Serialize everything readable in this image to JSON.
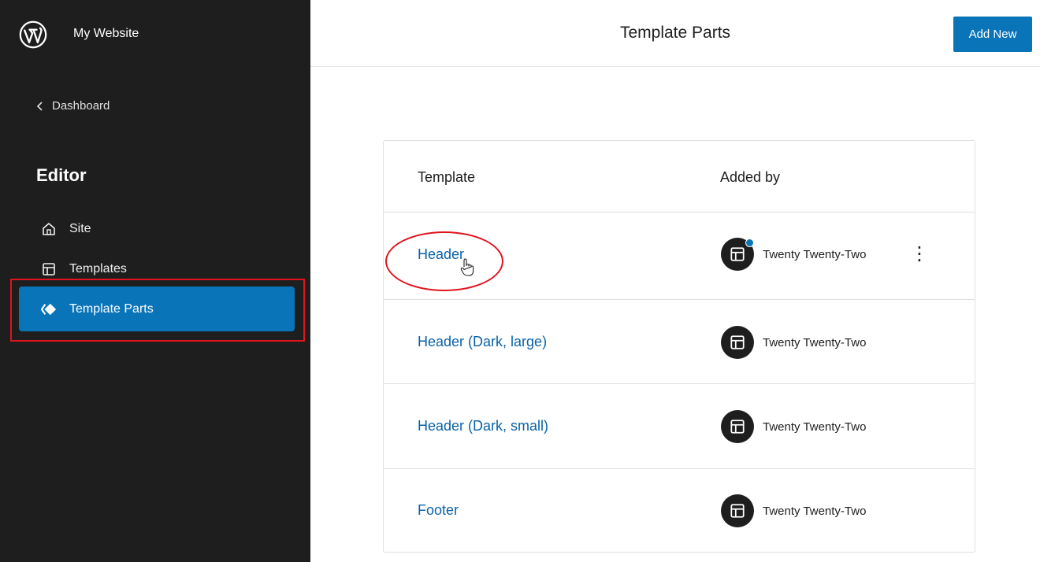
{
  "sidebar": {
    "site_title": "My Website",
    "back_label": "Dashboard",
    "section_heading": "Editor",
    "items": [
      {
        "label": "Site",
        "icon": "home-icon"
      },
      {
        "label": "Templates",
        "icon": "layout-icon"
      },
      {
        "label": "Template Parts",
        "icon": "symbol-filled-icon",
        "active": true
      }
    ]
  },
  "header": {
    "title": "Template Parts",
    "add_new_label": "Add New"
  },
  "table": {
    "columns": [
      "Template",
      "Added by"
    ],
    "rows": [
      {
        "name": "Header",
        "added_by": "Twenty Twenty-Two",
        "has_actions": true,
        "has_indicator": true
      },
      {
        "name": "Header (Dark, large)",
        "added_by": "Twenty Twenty-Two"
      },
      {
        "name": "Header (Dark, small)",
        "added_by": "Twenty Twenty-Two"
      },
      {
        "name": "Footer",
        "added_by": "Twenty Twenty-Two"
      }
    ]
  },
  "colors": {
    "sidebar_bg": "#1e1e1e",
    "accent": "#0a74b8",
    "link": "#0a62a8",
    "annotation": "#e0141e"
  }
}
